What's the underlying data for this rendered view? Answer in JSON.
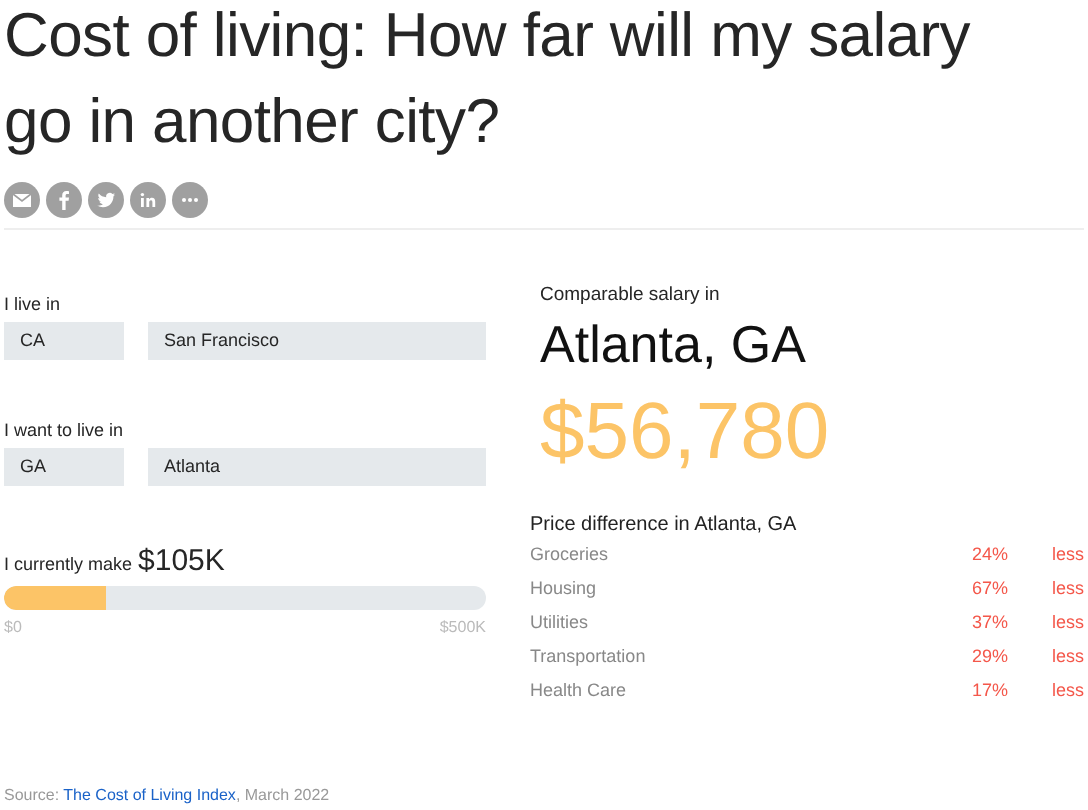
{
  "title": "Cost of living: How far will my salary go in another city?",
  "share": [
    {
      "kind": "email"
    },
    {
      "kind": "facebook"
    },
    {
      "kind": "twitter"
    },
    {
      "kind": "linkedin"
    },
    {
      "kind": "more"
    }
  ],
  "from": {
    "label": "I live in",
    "state": "CA",
    "city": "San Francisco"
  },
  "to": {
    "label": "I want to live in",
    "state": "GA",
    "city": "Atlanta"
  },
  "salary": {
    "label": "I currently make",
    "value": "$105K",
    "level": 0.21,
    "min": "$0",
    "max": "$500K"
  },
  "result": {
    "label": "Comparable salary in",
    "city": "Atlanta, GA",
    "amount": "$56,780"
  },
  "differences": {
    "title": "Price difference in Atlanta, GA",
    "rows": [
      {
        "category": "Groceries",
        "percent": "24%",
        "direction": "less"
      },
      {
        "category": "Housing",
        "percent": "67%",
        "direction": "less"
      },
      {
        "category": "Utilities",
        "percent": "37%",
        "direction": "less"
      },
      {
        "category": "Transportation",
        "percent": "29%",
        "direction": "less"
      },
      {
        "category": "Health Care",
        "percent": "17%",
        "direction": "less"
      }
    ]
  },
  "source": {
    "prefix": "Source: ",
    "link": "The Cost of Living Index",
    "suffix": ", March 2022"
  }
}
